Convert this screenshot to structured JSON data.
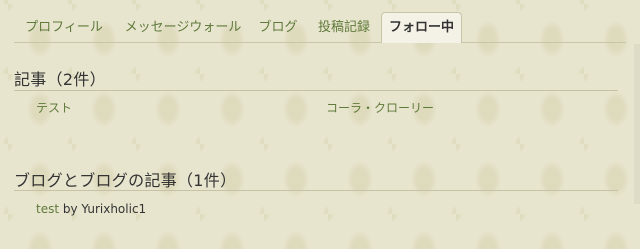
{
  "tabs": [
    {
      "label": "プロフィール"
    },
    {
      "label": "メッセージウォール"
    },
    {
      "label": "ブログ"
    },
    {
      "label": "投稿記録"
    },
    {
      "label": "フォロー中"
    }
  ],
  "active_tab_index": 4,
  "articles_section": {
    "title": "記事（2件）",
    "items": [
      {
        "label": "テスト"
      },
      {
        "label": "コーラ・クローリー"
      }
    ]
  },
  "blogs_section": {
    "title": "ブログとブログの記事（1件）",
    "item_link": "test",
    "item_by": " by Yurixholic1"
  },
  "colors": {
    "link": "#5f7a3a",
    "text": "#333333",
    "background": "#e8e5cf"
  }
}
